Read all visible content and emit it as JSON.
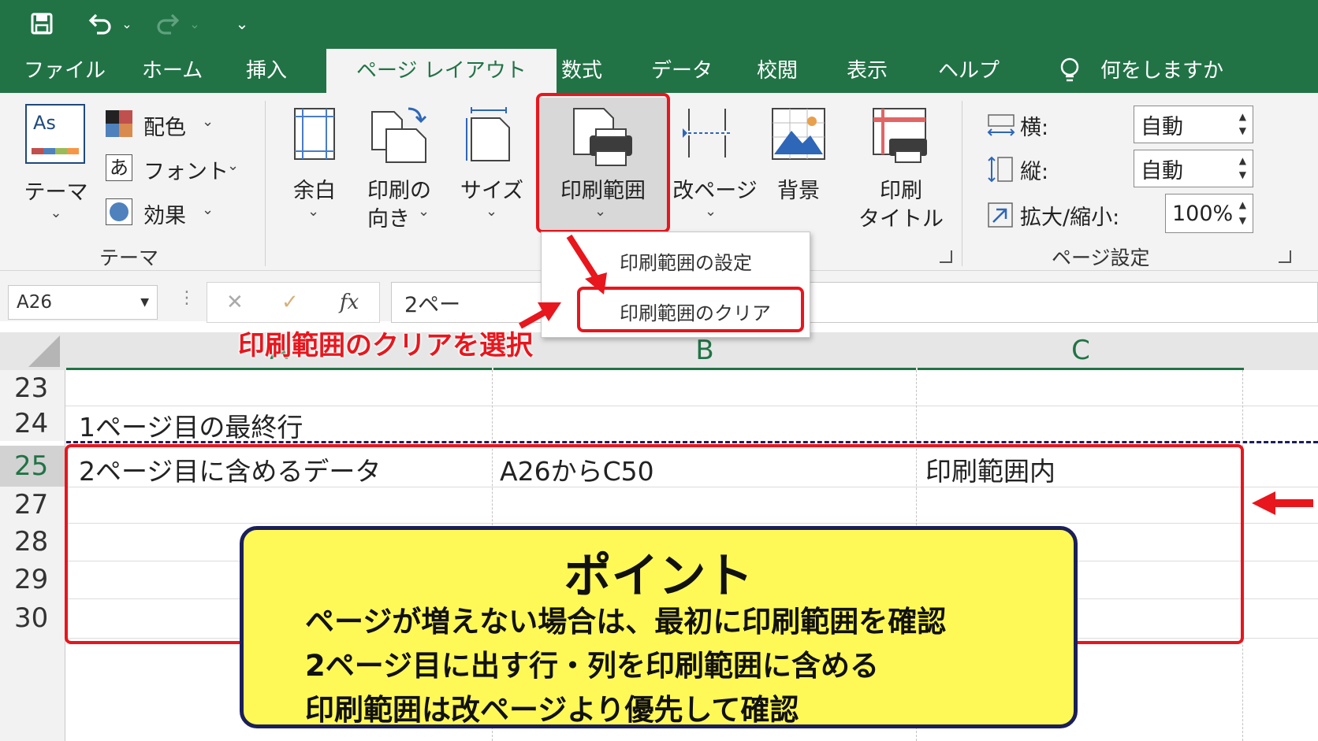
{
  "qat": {
    "save_icon": "save-icon",
    "undo_icon": "undo-icon",
    "redo_icon": "redo-icon",
    "customize_icon": "customize-qat-icon"
  },
  "tabs": [
    "ファイル",
    "ホーム",
    "挿入",
    "ページ レイアウト",
    "数式",
    "データ",
    "校閲",
    "表示",
    "ヘルプ"
  ],
  "tell_me": "何をしますか",
  "ribbon": {
    "themes": {
      "themes_label": "テーマ",
      "colors": "配色",
      "fonts": "フォント",
      "effects": "効果",
      "group": "テーマ",
      "font_icon_char": "あ"
    },
    "page_setup": {
      "margins": "余白",
      "orientation_l1": "印刷の",
      "orientation_l2": "向き",
      "size": "サイズ",
      "print_area": "印刷範囲",
      "breaks": "改ページ",
      "background": "背景",
      "print_titles_l1": "印刷",
      "print_titles_l2": "タイトル"
    },
    "scale": {
      "width_label": "横:",
      "width_value": "自動",
      "height_label": "縦:",
      "height_value": "自動",
      "scale_label": "拡大/縮小:",
      "scale_value": "100%",
      "group": "ページ設定"
    }
  },
  "dropdown": {
    "set_print_area": "印刷範囲の設定",
    "clear_print_area": "印刷範囲のクリア"
  },
  "formula_bar": {
    "name_box": "A26",
    "cancel": "✕",
    "enter": "✓",
    "fx": "fx",
    "content": "2ペー"
  },
  "columns": [
    "A",
    "B",
    "C"
  ],
  "rows": [
    {
      "num": "23",
      "a": "",
      "b": "",
      "c": ""
    },
    {
      "num": "24",
      "a": "1ページ目の最終行",
      "b": "",
      "c": ""
    },
    {
      "num": "25",
      "a": "2ページ目に含めるデータ",
      "b": "A26からC50",
      "c": "印刷範囲内"
    },
    {
      "num": "27",
      "a": "",
      "b": "",
      "c": ""
    },
    {
      "num": "28",
      "a": "",
      "b": "",
      "c": ""
    },
    {
      "num": "29",
      "a": "",
      "b": "",
      "c": ""
    },
    {
      "num": "30",
      "a": "",
      "b": "",
      "c": ""
    }
  ],
  "annotation": "印刷範囲のクリアを選択",
  "callout": {
    "title": "ポイント",
    "lines": [
      "ページが増えない場合は、最初に印刷範囲を確認",
      "2ページ目に出す行・列を印刷範囲に含める",
      "印刷範囲は改ページより優先して確認"
    ]
  },
  "colors": {
    "excel_green": "#217346",
    "ribbon_bg": "#f3f3f3",
    "highlight_red": "#e8161d",
    "callout_yellow": "#fff957",
    "callout_border": "#1b1f5a"
  }
}
